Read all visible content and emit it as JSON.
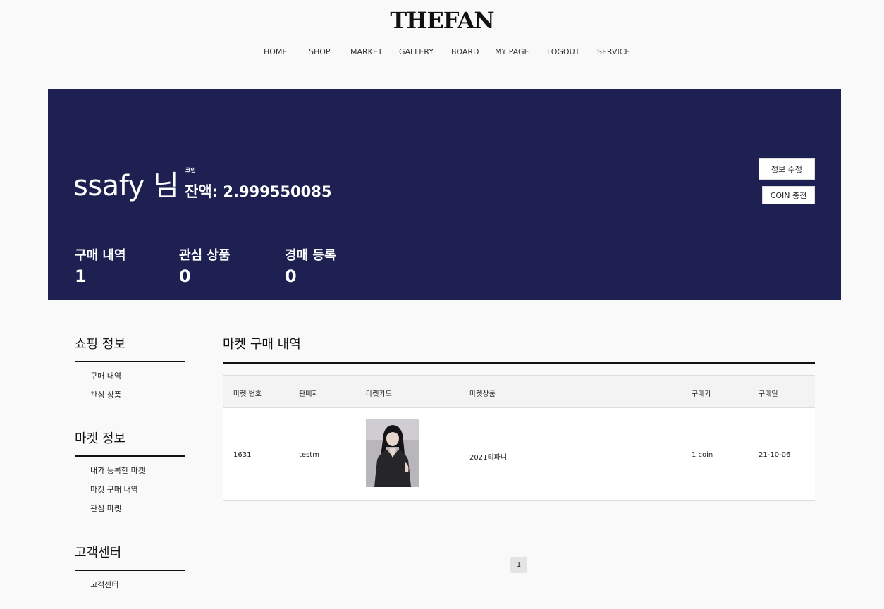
{
  "header": {
    "logo": "THEFAN",
    "nav": [
      "HOME",
      "SHOP",
      "MARKET",
      "GALLERY",
      "BOARD",
      "MY PAGE",
      "LOGOUT",
      "SERVICE"
    ]
  },
  "banner": {
    "username": "ssafy 님",
    "coin_tiny": "코인",
    "balance": "잔액: 2.999550085",
    "edit_button": "정보 수정",
    "coin_button": "COIN 충전",
    "stats": [
      {
        "label": "구매 내역",
        "value": "1"
      },
      {
        "label": "관심 상품",
        "value": "0"
      },
      {
        "label": "경매 등록",
        "value": "0"
      }
    ]
  },
  "sidebar": {
    "sections": [
      {
        "title": "쇼핑 정보",
        "links": [
          "구매 내역",
          "관심 상품"
        ]
      },
      {
        "title": "마켓 정보",
        "links": [
          "내가 등록한 마켓",
          "마켓 구매 내역",
          "관심 마켓"
        ]
      },
      {
        "title": "고객센터",
        "links": [
          "고객센터"
        ]
      }
    ]
  },
  "main": {
    "title": "마켓 구매 내역",
    "columns": [
      "마켓 번호",
      "판매자",
      "마켓카드",
      "마켓상품",
      "구매가",
      "구매일"
    ],
    "rows": [
      {
        "id": "1631",
        "seller": "testm",
        "card": "card-photo",
        "product": "2021티파니",
        "price": "1 coin",
        "date": "21-10-06"
      }
    ],
    "page": "1"
  },
  "colors": {
    "banner_bg": "#1e2052",
    "page_bg": "#f9f9f9"
  }
}
